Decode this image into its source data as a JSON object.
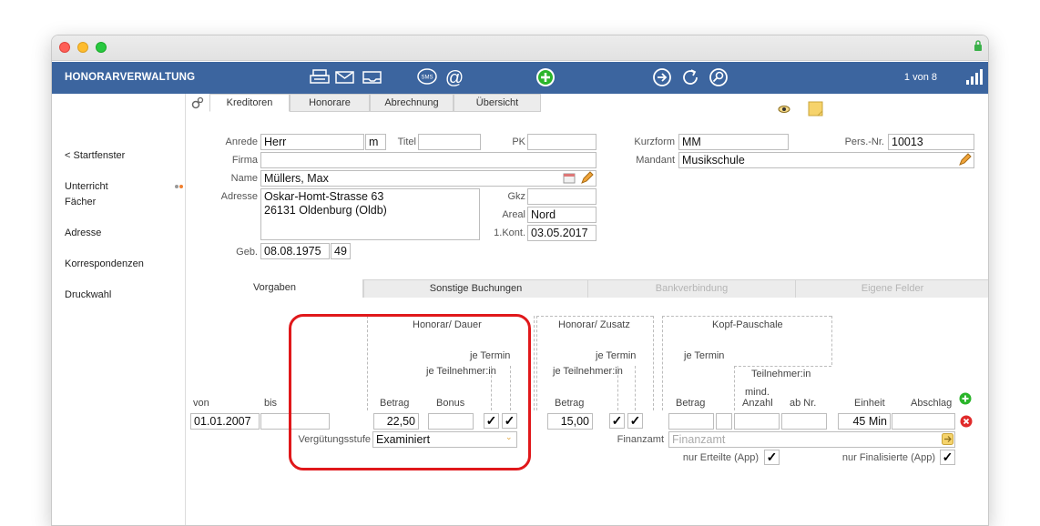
{
  "app_title": "HONORARVERWALTUNG",
  "record_position": "1 von 8",
  "sidebar": {
    "items": [
      "< Startfenster",
      "Unterricht",
      "Fächer",
      "Adresse",
      "Korrespondenzen",
      "Druckwahl"
    ]
  },
  "top_tabs": [
    "Kreditoren",
    "Honorare",
    "Abrechnung",
    "Übersicht"
  ],
  "form": {
    "anrede_label": "Anrede",
    "anrede_value": "Herr",
    "gender_value": "m",
    "titel_label": "Titel",
    "titel_value": "",
    "pk_label": "PK",
    "pk_value": "",
    "firma_label": "Firma",
    "firma_value": "",
    "name_label": "Name",
    "name_value": "Müllers, Max",
    "adresse_label": "Adresse",
    "adresse_line1": "Oskar-Homt-Strasse 63",
    "adresse_line2": "26131 Oldenburg (Oldb)",
    "gkz_label": "Gkz",
    "gkz_value": "",
    "areal_label": "Areal",
    "areal_value": "Nord",
    "kont_label": "1.Kont.",
    "kont_value": "03.05.2017",
    "geb_label": "Geb.",
    "geb_value": "08.08.1975",
    "age_value": "49",
    "kurzform_label": "Kurzform",
    "kurzform_value": "MM",
    "persnr_label": "Pers.-Nr.",
    "persnr_value": "10013",
    "mandant_label": "Mandant",
    "mandant_value": "Musikschule"
  },
  "bottom_tabs": [
    "Vorgaben",
    "Sonstige Buchungen",
    "Bankverbindung",
    "Eigene Felder"
  ],
  "grid": {
    "group_honorar_dauer": "Honorar/ Dauer",
    "group_honorar_zusatz": "Honorar/ Zusatz",
    "group_kopf": "Kopf-Pauschale",
    "je_termin": "je Termin",
    "je_teilnehmer": "je Teilnehmer:in",
    "teilnehmer": "Teilnehmer:in",
    "col_von": "von",
    "col_bis": "bis",
    "col_betrag": "Betrag",
    "col_bonus": "Bonus",
    "col_mind": "mind.",
    "col_anzahl": "Anzahl",
    "col_abnr": "ab Nr.",
    "col_einheit": "Einheit",
    "col_abschlag": "Abschlag",
    "von_value": "01.01.2007",
    "bis_value": "",
    "betrag_value": "22,50",
    "bonus_value": "",
    "zusatz_betrag_value": "15,00",
    "einheit_value": "45 Min",
    "check_mark": "✓",
    "verguetung_label": "Vergütungsstufe",
    "verguetung_value": "Examiniert",
    "finanzamt_label": "Finanzamt",
    "finanzamt_placeholder": "Finanzamt",
    "nur_erteilte_label": "nur Erteilte (App)",
    "nur_finalisierte_label": "nur Finalisierte (App)"
  },
  "colors": {
    "topbar": "#3c659f",
    "highlight": "#e0181b",
    "add": "#2ab52a",
    "remove": "#e02a2a"
  },
  "icons": [
    "printer-icon",
    "mail-icon",
    "mail-open-icon",
    "sms-icon",
    "at-icon",
    "add-icon",
    "forward-icon",
    "refresh-icon",
    "search-icon",
    "signal-icon",
    "lock-icon",
    "gear-icon",
    "eye-icon",
    "note-icon",
    "calendar-icon",
    "pencil-icon"
  ]
}
